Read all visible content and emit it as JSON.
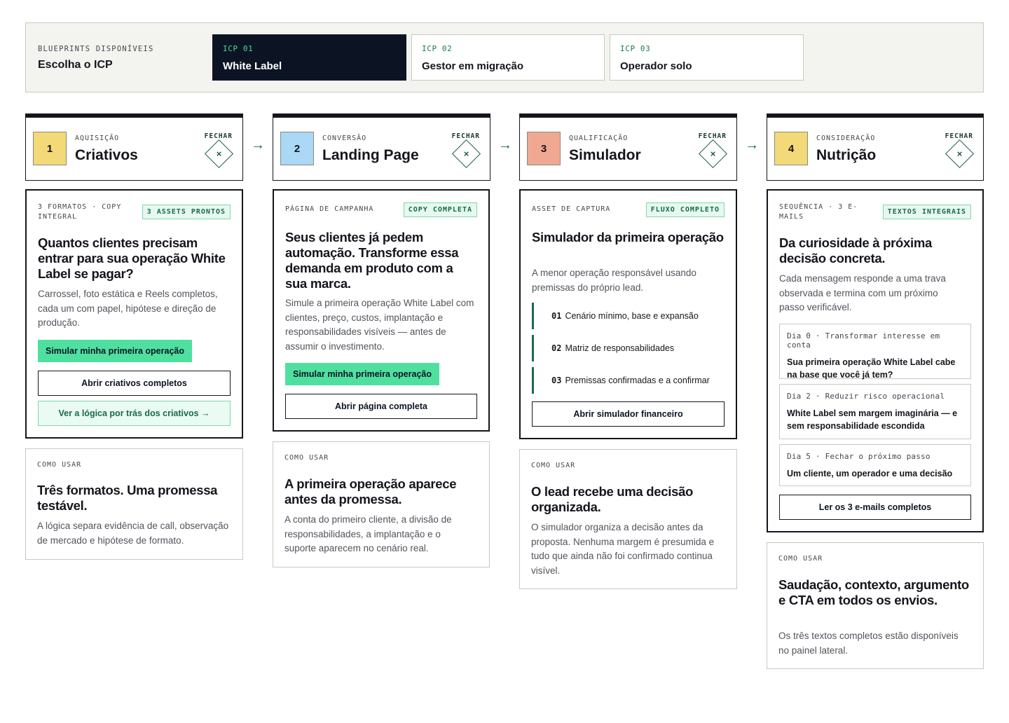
{
  "icp_selector": {
    "kicker": "BLUEPRINTS DISPONÍVEIS",
    "heading": "Escolha o ICP",
    "tabs": [
      {
        "code": "ICP 01",
        "label": "White Label"
      },
      {
        "code": "ICP 02",
        "label": "Gestor em migração"
      },
      {
        "code": "ICP 03",
        "label": "Operador solo"
      }
    ]
  },
  "stages": [
    {
      "number": "1",
      "kicker": "AQUISIÇÃO",
      "title": "Criativos",
      "close_label": "FECHAR",
      "close_symbol": "×",
      "color": "#f3d978",
      "card": {
        "kicker": "3 FORMATOS · COPY INTEGRAL",
        "badge": "3 ASSETS PRONTOS",
        "title": "Quantos clientes precisam entrar para sua operação White Label se pagar?",
        "body": "Carrossel, foto estática e Reels completos, cada um com papel, hipótese e direção de produção.",
        "primary_button": "Simular minha primeira operação",
        "outline_button": "Abrir criativos completos",
        "ghost_button": "Ver a lógica por trás dos criativos →"
      },
      "usage": {
        "kicker": "COMO USAR",
        "title": "Três formatos. Uma promessa testável.",
        "body": "A lógica separa evidência de call, observação de mercado e hipótese de formato."
      }
    },
    {
      "number": "2",
      "kicker": "CONVERSÃO",
      "title": "Landing Page",
      "close_label": "FECHAR",
      "close_symbol": "×",
      "color": "#abd8f5",
      "card": {
        "kicker": "PÁGINA DE CAMPANHA",
        "badge": "COPY COMPLETA",
        "title": "Seus clientes já pedem automação. Transforme essa demanda em produto com a sua marca.",
        "body": "Simule a primeira operação White Label com clientes, preço, custos, implantação e responsabilidades visíveis — antes de assumir o investimento.",
        "primary_button": "Simular minha primeira operação",
        "outline_button": "Abrir página completa"
      },
      "usage": {
        "kicker": "COMO USAR",
        "title": "A primeira operação aparece antes da promessa.",
        "body": "A conta do primeiro cliente, a divisão de responsabilidades, a implantação e o suporte aparecem no cenário real."
      }
    },
    {
      "number": "3",
      "kicker": "QUALIFICAÇÃO",
      "title": "Simulador",
      "close_label": "FECHAR",
      "close_symbol": "×",
      "color": "#f0a892",
      "card": {
        "kicker": "ASSET DE CAPTURA",
        "badge": "FLUXO COMPLETO",
        "title": "Simulador da primeira operação",
        "body": "A menor operação responsável usando premissas do próprio lead.",
        "checklist": [
          {
            "num": "01",
            "text": "Cenário mínimo, base e expansão"
          },
          {
            "num": "02",
            "text": "Matriz de responsabilidades"
          },
          {
            "num": "03",
            "text": "Premissas confirmadas e a confirmar"
          }
        ],
        "outline_button": "Abrir simulador financeiro"
      },
      "usage": {
        "kicker": "COMO USAR",
        "title": "O lead recebe uma decisão organizada.",
        "body": "O simulador organiza a decisão antes da proposta. Nenhuma margem é presumida e tudo que ainda não foi confirmado continua visível."
      }
    },
    {
      "number": "4",
      "kicker": "CONSIDERAÇÃO",
      "title": "Nutrição",
      "close_label": "FECHAR",
      "close_symbol": "×",
      "color": "#f3d978",
      "card": {
        "kicker": "SEQUÊNCIA · 3 E-MAILS",
        "badge": "TEXTOS INTEGRAIS",
        "title": "Da curiosidade à próxima decisão concreta.",
        "body": "Cada mensagem responde a uma trava observada e termina com um próximo passo verificável.",
        "emails": [
          {
            "day": "Dia 0 · Transformar interesse em conta",
            "subject": "Sua primeira operação White Label cabe na base que você já tem?"
          },
          {
            "day": "Dia 2 · Reduzir risco operacional",
            "subject": "White Label sem margem imaginária — e sem responsabilidade escondida"
          },
          {
            "day": "Dia 5 · Fechar o próximo passo",
            "subject": "Um cliente, um operador e uma decisão"
          }
        ],
        "outline_button": "Ler os 3 e-mails completos"
      },
      "usage": {
        "kicker": "COMO USAR",
        "title": "Saudação, contexto, argumento e CTA em todos os envios.",
        "body": "Os três textos completos estão disponíveis no painel lateral."
      }
    }
  ],
  "flow_arrow": "→",
  "colors": {
    "accent": "#4fe0a0",
    "dark": "#0c1424",
    "green": "#1a6a4c"
  }
}
